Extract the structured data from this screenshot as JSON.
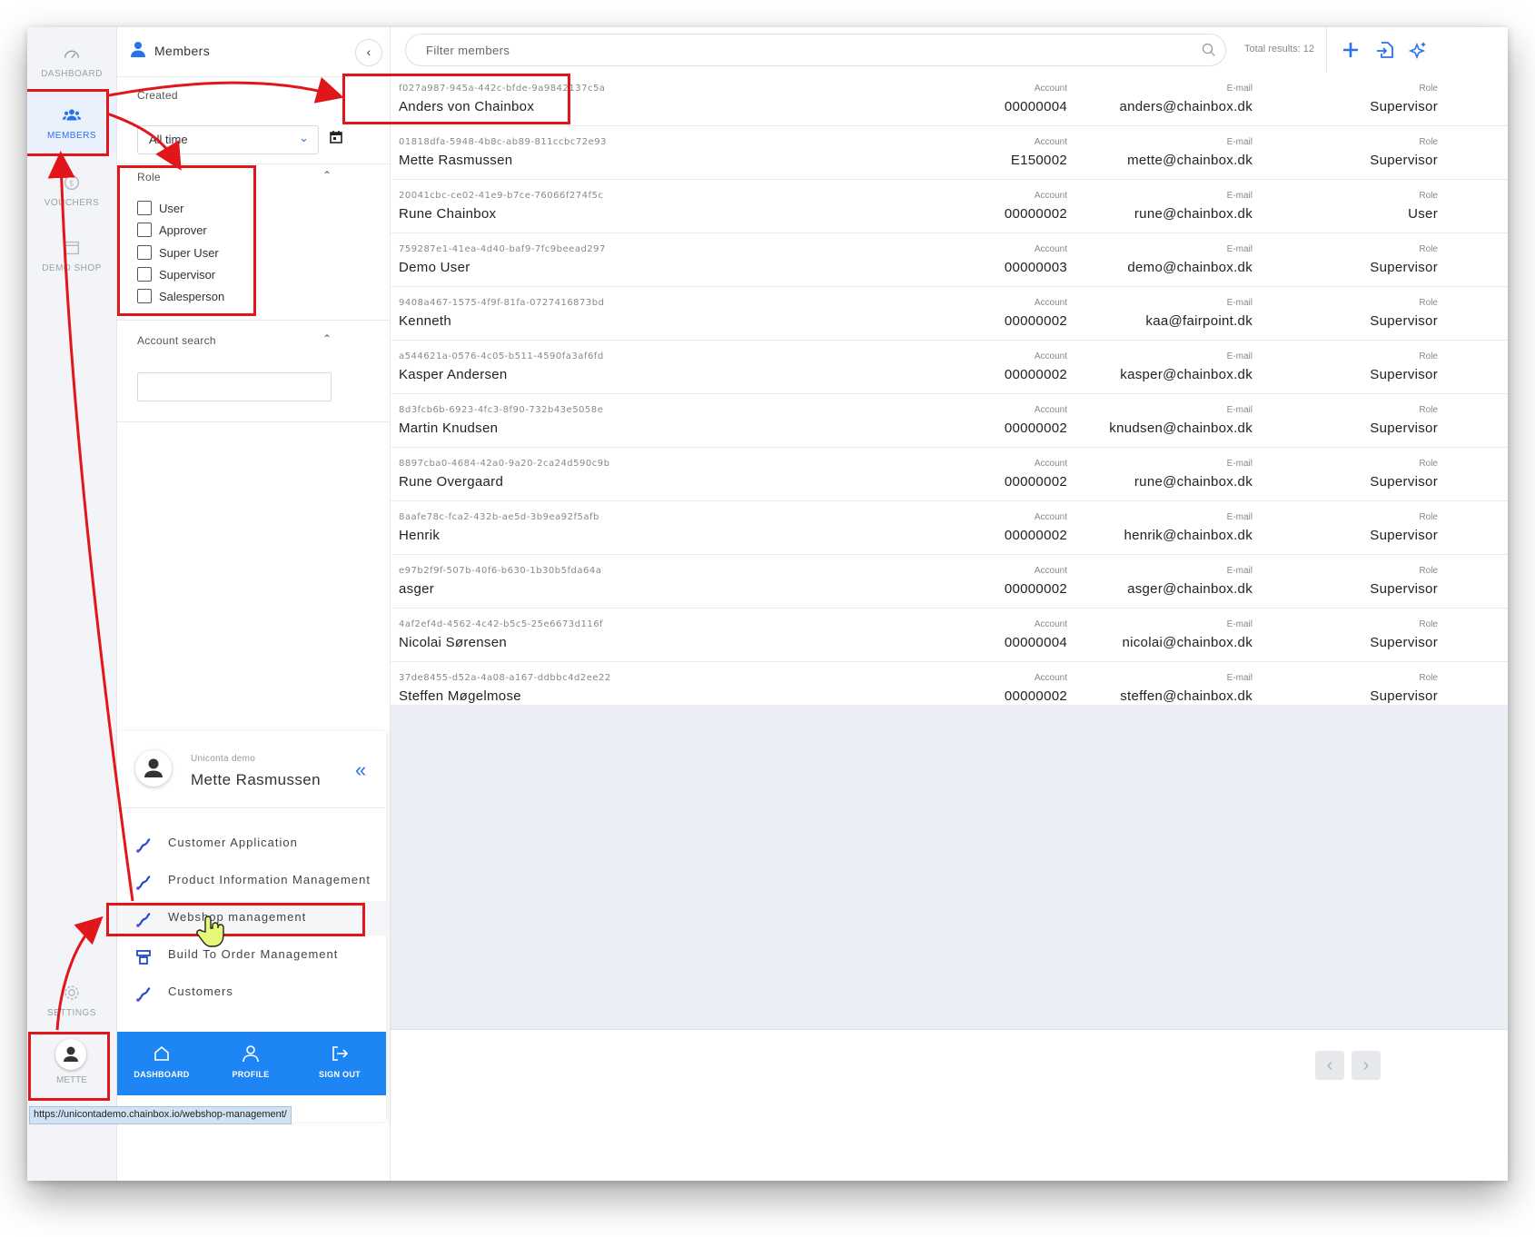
{
  "rail": {
    "dashboard": "DASHBOARD",
    "members": "MEMBERS",
    "vouchers": "VOUCHERS",
    "demo_shop": "DEMO SHOP",
    "settings": "SETTINGS",
    "user": "METTE"
  },
  "panel": {
    "title": "Members",
    "created_label": "Created",
    "created_value": "All time",
    "role_label": "Role",
    "roles": [
      "User",
      "Approver",
      "Super User",
      "Supervisor",
      "Salesperson"
    ],
    "account_search_label": "Account search"
  },
  "topbar": {
    "search_placeholder": "Filter members",
    "total": "Total results: 12"
  },
  "columns": {
    "account": "Account",
    "email": "E-mail",
    "role": "Role"
  },
  "members": [
    {
      "id": "f027a987-945a-442c-bfde-9a9842137c5a",
      "name": "Anders von Chainbox",
      "account": "00000004",
      "email": "anders@chainbox.dk",
      "role": "Supervisor"
    },
    {
      "id": "01818dfa-5948-4b8c-ab89-811ccbc72e93",
      "name": "Mette Rasmussen",
      "account": "E150002",
      "email": "mette@chainbox.dk",
      "role": "Supervisor"
    },
    {
      "id": "20041cbc-ce02-41e9-b7ce-76066f274f5c",
      "name": "Rune Chainbox",
      "account": "00000002",
      "email": "rune@chainbox.dk",
      "role": "User"
    },
    {
      "id": "759287e1-41ea-4d40-baf9-7fc9beead297",
      "name": "Demo User",
      "account": "00000003",
      "email": "demo@chainbox.dk",
      "role": "Supervisor"
    },
    {
      "id": "9408a467-1575-4f9f-81fa-0727416873bd",
      "name": "Kenneth",
      "account": "00000002",
      "email": "kaa@fairpoint.dk",
      "role": "Supervisor"
    },
    {
      "id": "a544621a-0576-4c05-b511-4590fa3af6fd",
      "name": "Kasper Andersen",
      "account": "00000002",
      "email": "kasper@chainbox.dk",
      "role": "Supervisor"
    },
    {
      "id": "8d3fcb6b-6923-4fc3-8f90-732b43e5058e",
      "name": "Martin Knudsen",
      "account": "00000002",
      "email": "knudsen@chainbox.dk",
      "role": "Supervisor"
    },
    {
      "id": "8897cba0-4684-42a0-9a20-2ca24d590c9b",
      "name": "Rune Overgaard",
      "account": "00000002",
      "email": "rune@chainbox.dk",
      "role": "Supervisor"
    },
    {
      "id": "8aafe78c-fca2-432b-ae5d-3b9ea92f5afb",
      "name": "Henrik",
      "account": "00000002",
      "email": "henrik@chainbox.dk",
      "role": "Supervisor"
    },
    {
      "id": "e97b2f9f-507b-40f6-b630-1b30b5fda64a",
      "name": "asger",
      "account": "00000002",
      "email": "asger@chainbox.dk",
      "role": "Supervisor"
    },
    {
      "id": "4af2ef4d-4562-4c42-b5c5-25e6673d116f",
      "name": "Nicolai Sørensen",
      "account": "00000004",
      "email": "nicolai@chainbox.dk",
      "role": "Supervisor"
    },
    {
      "id": "37de8455-d52a-4a08-a167-ddbbc4d2ee22",
      "name": "Steffen Møgelmose",
      "account": "00000002",
      "email": "steffen@chainbox.dk",
      "role": "Supervisor"
    }
  ],
  "flyout": {
    "company": "Uniconta demo",
    "user_name": "Mette Rasmussen",
    "apps": [
      "Customer Application",
      "Product Information Management",
      "Webshop management",
      "Build To Order Management",
      "Customers"
    ],
    "footer": {
      "dashboard": "DASHBOARD",
      "profile": "PROFILE",
      "sign_out": "SIGN OUT"
    }
  },
  "status_url": "https://unicontademo.chainbox.io/webshop-management/",
  "colors": {
    "accent": "#2a72e8",
    "footer_blue": "#1e86f4",
    "annotation_red": "#e0161b"
  }
}
